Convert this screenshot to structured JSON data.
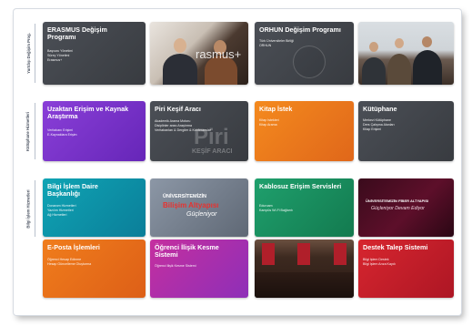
{
  "sections": [
    {
      "label": "Yurtdışı Değişim Prog.",
      "cards": [
        {
          "id": "erasmus",
          "title": "ERASMUS Değişim Programı",
          "lines": [
            "Başvuru Yönetimi",
            "Süreç Yönetimi",
            "Erasmus+"
          ]
        },
        {
          "id": "erasmus-photo",
          "watermark": "rasmus+"
        },
        {
          "id": "orhun",
          "title": "ORHUN Değişim Programı",
          "lines": [
            "Türk Üniversiteler Birliği",
            "ORHUN"
          ]
        },
        {
          "id": "students-photo"
        }
      ]
    },
    {
      "label": "Kütüphane Hizmetleri",
      "cards": [
        {
          "id": "remote",
          "title": "Uzaktan Erişim ve Kaynak Araştırma",
          "lines": [
            "Veritabanı Erişimi",
            "E-Kaynaklara Erişim"
          ]
        },
        {
          "id": "piri",
          "title": "Piri Keşif Aracı",
          "lines": [
            "Akademik Arama Motoru",
            "Disiplinler arası Araştırma",
            "Veritabanları & Dergiler & Konferanslar"
          ],
          "watermark": "Piri",
          "watermark_sub": "KEŞİF ARACI"
        },
        {
          "id": "kitap",
          "title": "Kitap İstek",
          "lines": [
            "Kitap İstekleri",
            "Kitap Arama"
          ]
        },
        {
          "id": "kutuphane",
          "title": "Kütüphane",
          "lines": [
            "Merkezi Kütüphane",
            "Ders Çalışma Alanları",
            "Kitap Erişimi"
          ]
        }
      ]
    },
    {
      "label": "Bilgi İşlem Hizmetleri",
      "cards": [
        {
          "id": "bidb",
          "title": "Bilgi İşlem Daire Başkanlığı",
          "lines": [
            "Donanım Hizmetleri",
            "Yazılım Hizmetleri",
            "Ağ Hizmetleri"
          ]
        },
        {
          "id": "altyapi",
          "banner_top": "ÜNİVERSİTEMİZİN",
          "banner_mid": "Bilişim Altyapısı",
          "banner_bot": "Güçleniyor"
        },
        {
          "id": "wifi",
          "title": "Kablosuz Erişim Servisleri",
          "lines": [
            "Eduroam",
            "Kampüs Wi-Fi Bağlantı"
          ]
        },
        {
          "id": "fiber",
          "banner_top": "ÜNİVERSİTEMİZİN FİBER ALTYAPISI",
          "banner_mid": "Güçleniyor Devam Ediyor"
        },
        {
          "id": "eposta",
          "title": "E-Posta İşlemleri",
          "lines": [
            "Öğrenci Hesap Edinme",
            "Hesap Güncelleme Oluşturma"
          ]
        },
        {
          "id": "iliskikesme",
          "title": "Öğrenci İlişik Kesme Sistemi",
          "lines": [
            "Öğrenci İlişik Kesme Sistemi"
          ]
        },
        {
          "id": "ceremony-photo"
        },
        {
          "id": "destek",
          "title": "Destek Talep Sistemi",
          "lines": [
            "Bilgi İşlem Destek",
            "Bilgi İşlem Arıza Kaydı"
          ]
        }
      ]
    }
  ],
  "colors": {
    "dark": "#45484e",
    "purple": "#7a33cc",
    "orange": "#ec7a1c",
    "teal": "#0d93aa",
    "green": "#199064",
    "magenta": "#ab2fab",
    "red": "#c41e2a"
  }
}
